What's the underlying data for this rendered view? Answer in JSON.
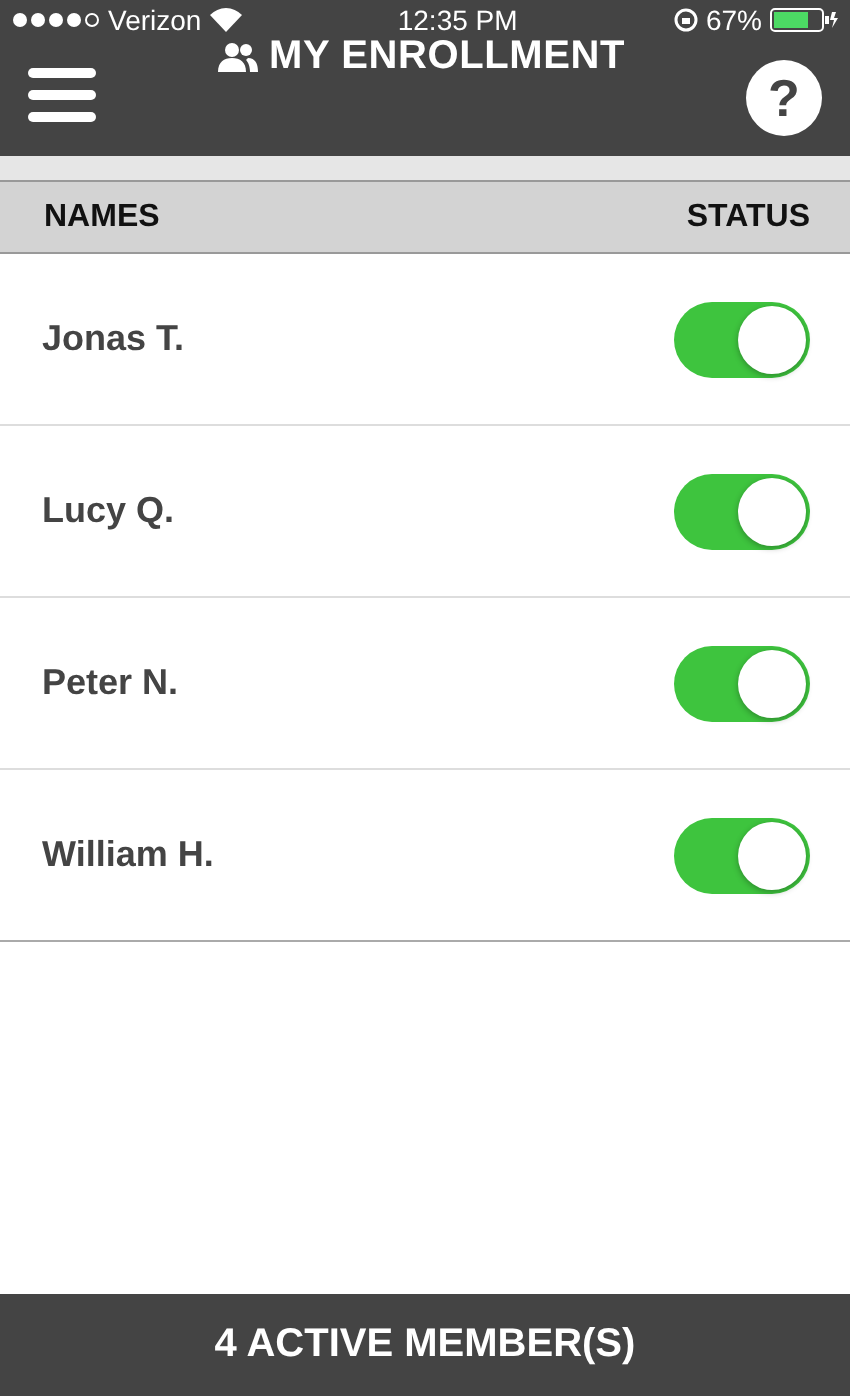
{
  "status_bar": {
    "carrier": "Verizon",
    "time": "12:35 PM",
    "battery": "67%"
  },
  "header": {
    "title": "MY ENROLLMENT",
    "help": "?"
  },
  "table": {
    "columns": [
      "NAMES",
      "STATUS"
    ],
    "rows": [
      {
        "name": "Jonas T.",
        "on": true
      },
      {
        "name": "Lucy Q.",
        "on": true
      },
      {
        "name": "Peter N.",
        "on": true
      },
      {
        "name": "William H.",
        "on": true
      }
    ]
  },
  "footer": {
    "text": "4 ACTIVE MEMBER(S)"
  }
}
